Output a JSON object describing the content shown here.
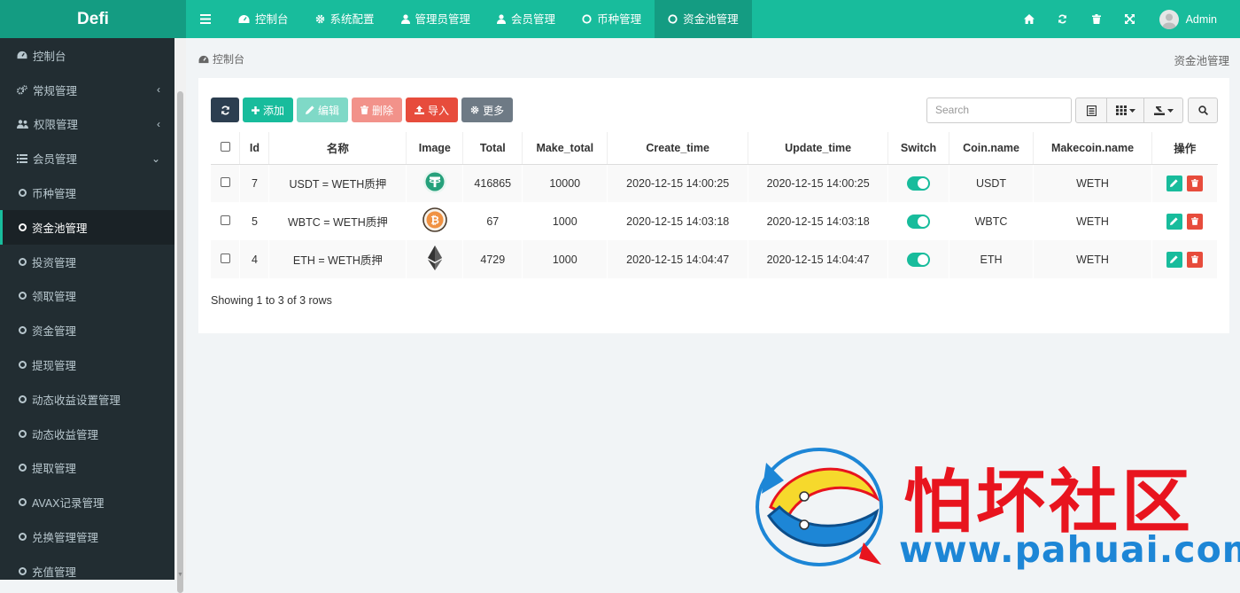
{
  "app": {
    "logo": "Defi"
  },
  "topnav": {
    "tabs": [
      {
        "label": "控制台",
        "icon": "dashboard-icon"
      },
      {
        "label": "系统配置",
        "icon": "gear-icon"
      },
      {
        "label": "管理员管理",
        "icon": "user-icon"
      },
      {
        "label": "会员管理",
        "icon": "user-icon"
      },
      {
        "label": "币种管理",
        "icon": "circle-icon"
      },
      {
        "label": "资金池管理",
        "icon": "circle-icon",
        "active": true
      }
    ],
    "user_name": "Admin"
  },
  "sidebar": {
    "items": [
      {
        "label": "控制台",
        "icon": "dashboard-icon"
      },
      {
        "label": "常规管理",
        "icon": "gears-icon",
        "caret": "‹"
      },
      {
        "label": "权限管理",
        "icon": "users-icon",
        "caret": "‹"
      },
      {
        "label": "会员管理",
        "icon": "list-icon",
        "caret": "⌄"
      },
      {
        "label": "币种管理",
        "icon": "circle-icon"
      },
      {
        "label": "资金池管理",
        "icon": "circle-icon",
        "active": true
      },
      {
        "label": "投资管理",
        "icon": "circle-icon"
      },
      {
        "label": "领取管理",
        "icon": "circle-icon"
      },
      {
        "label": "资金管理",
        "icon": "circle-icon"
      },
      {
        "label": "提现管理",
        "icon": "circle-icon"
      },
      {
        "label": "动态收益设置管理",
        "icon": "circle-icon"
      },
      {
        "label": "动态收益管理",
        "icon": "circle-icon"
      },
      {
        "label": "提取管理",
        "icon": "circle-icon"
      },
      {
        "label": "AVAX记录管理",
        "icon": "circle-icon"
      },
      {
        "label": "兑换管理管理",
        "icon": "circle-icon"
      },
      {
        "label": "充值管理",
        "icon": "circle-icon"
      }
    ]
  },
  "breadcrumb": {
    "home": "控制台",
    "current": "资金池管理"
  },
  "toolbar": {
    "add": "添加",
    "edit": "编辑",
    "delete": "删除",
    "import": "导入",
    "more": "更多",
    "search_placeholder": "Search"
  },
  "table": {
    "columns": [
      "Id",
      "名称",
      "Image",
      "Total",
      "Make_total",
      "Create_time",
      "Update_time",
      "Switch",
      "Coin.name",
      "Makecoin.name",
      "操作"
    ],
    "rows": [
      {
        "id": "7",
        "name": "USDT = WETH质押",
        "image": "tether-icon",
        "total": "416865",
        "make_total": "10000",
        "create_time": "2020-12-15 14:00:25",
        "update_time": "2020-12-15 14:00:25",
        "switch": true,
        "coin": "USDT",
        "makecoin": "WETH"
      },
      {
        "id": "5",
        "name": "WBTC = WETH质押",
        "image": "bitcoin-icon",
        "total": "67",
        "make_total": "1000",
        "create_time": "2020-12-15 14:03:18",
        "update_time": "2020-12-15 14:03:18",
        "switch": true,
        "coin": "WBTC",
        "makecoin": "WETH"
      },
      {
        "id": "4",
        "name": "ETH = WETH质押",
        "image": "ethereum-icon",
        "total": "4729",
        "make_total": "1000",
        "create_time": "2020-12-15 14:04:47",
        "update_time": "2020-12-15 14:04:47",
        "switch": true,
        "coin": "ETH",
        "makecoin": "WETH"
      }
    ],
    "footer": "Showing 1 to 3 of 3 rows"
  },
  "watermark": {
    "title": "怕坏社区",
    "url": "www.pahuai.com"
  },
  "colors": {
    "primary": "#18bc9c",
    "sidebar": "#222d32",
    "danger": "#e74c3c",
    "dark": "#2c3e50"
  }
}
